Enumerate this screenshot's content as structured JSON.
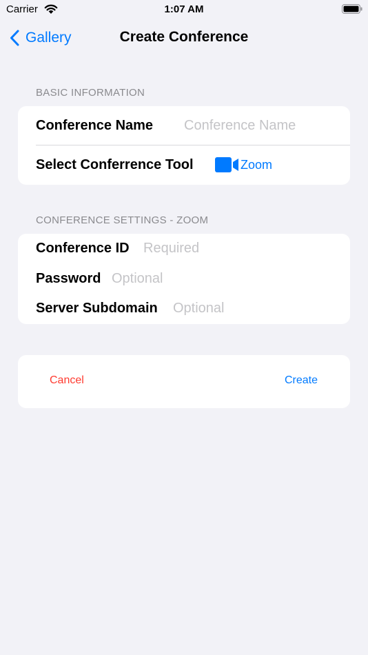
{
  "status_bar": {
    "carrier": "Carrier",
    "time": "1:07 AM"
  },
  "nav": {
    "back_label": "Gallery",
    "title": "Create Conference"
  },
  "basic": {
    "header": "BASIC INFORMATION",
    "name_label": "Conference Name",
    "name_placeholder": "Conference Name",
    "tool_label": "Select Conferrence Tool",
    "tool_value": "Zoom"
  },
  "settings": {
    "header": "CONFERENCE SETTINGS - ZOOM",
    "id_label": "Conference ID",
    "id_placeholder": "Required",
    "password_label": "Password",
    "password_placeholder": "Optional",
    "subdomain_label": "Server Subdomain",
    "subdomain_placeholder": "Optional"
  },
  "actions": {
    "cancel": "Cancel",
    "create": "Create"
  },
  "colors": {
    "accent": "#007aff",
    "destructive": "#ff3b30",
    "background": "#f2f2f7"
  },
  "icons": [
    "wifi-icon",
    "battery-icon",
    "chevron-left-icon",
    "video-camera-icon"
  ]
}
